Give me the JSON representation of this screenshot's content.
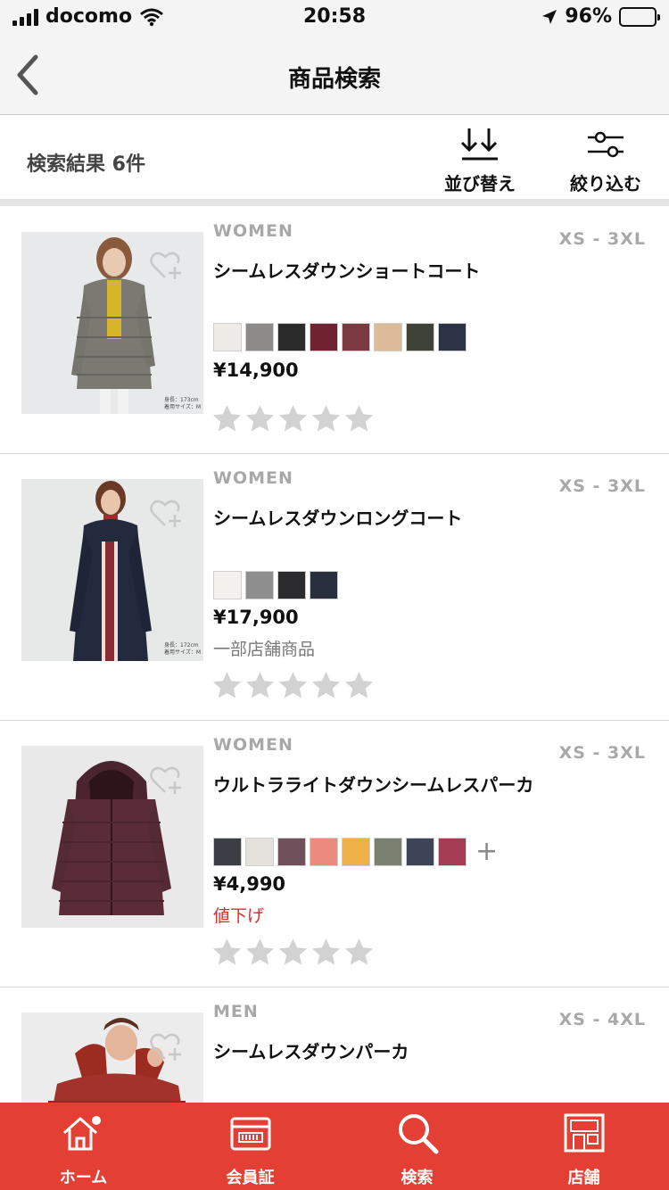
{
  "status_bar": {
    "carrier": "docomo",
    "time": "20:58",
    "battery": "96%"
  },
  "navbar": {
    "title": "商品検索",
    "back_icon": "chevron-left-icon"
  },
  "results": {
    "count_label": "検索結果 6件",
    "sort_label": "並び替え",
    "filter_label": "絞り込む"
  },
  "products": [
    {
      "gender": "WOMEN",
      "size": "XS - 3XL",
      "name": "シームレスダウンショートコート",
      "colors": [
        "#eeebe6",
        "#8d8b89",
        "#2b2b2b",
        "#6f2230",
        "#7a3a40",
        "#dcbc98",
        "#3f4237",
        "#2b3344"
      ],
      "more_colors": "",
      "price": "¥14,900",
      "note": "",
      "rating": 0
    },
    {
      "gender": "WOMEN",
      "size": "XS - 3XL",
      "name": "シームレスダウンロングコート",
      "colors": [
        "#f3f1ec",
        "#8e8e8e",
        "#2c2c2e",
        "#2a2f40"
      ],
      "more_colors": "",
      "price": "¥17,900",
      "note": "一部店舗商品",
      "rating": 0
    },
    {
      "gender": "WOMEN",
      "size": "XS - 3XL",
      "name": "ウルトラライトダウンシームレスパーカ",
      "colors": [
        "#3c3e45",
        "#e4e0dc",
        "#70505a",
        "#ec8a7e",
        "#eeb148",
        "#7a8170",
        "#3d4457",
        "#a53d54"
      ],
      "more_colors": "+",
      "price": "¥4,990",
      "note": "値下げ",
      "rating": 0
    },
    {
      "gender": "MEN",
      "size": "XS - 4XL",
      "name": "シームレスダウンパーカ",
      "colors": [],
      "more_colors": "",
      "price": "",
      "note": "",
      "rating": 0
    }
  ],
  "thumb_captions": {
    "p0": [
      "身長：173cm",
      "着用サイズ：M"
    ],
    "p1": [
      "身長：172cm",
      "着用サイズ：M"
    ]
  },
  "tabbar": {
    "tabs": [
      {
        "label": "ホーム",
        "icon": "home-icon"
      },
      {
        "label": "会員証",
        "icon": "member-card-icon"
      },
      {
        "label": "検索",
        "icon": "search-icon"
      },
      {
        "label": "店舗",
        "icon": "store-icon"
      }
    ]
  },
  "colors": {
    "brand_red": "#e43f34",
    "price_drop_red": "#e02a2a",
    "muted_gray": "#a8a8a8"
  }
}
